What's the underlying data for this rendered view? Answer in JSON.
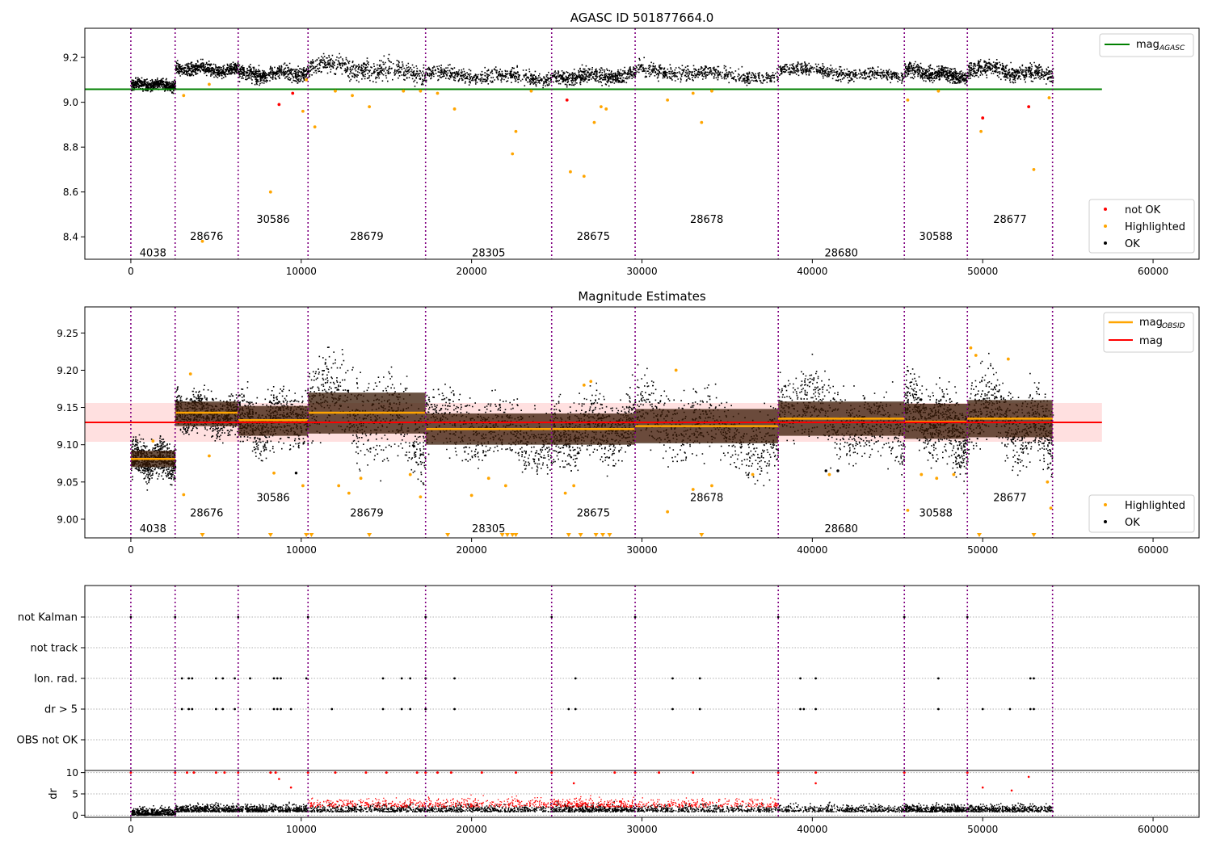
{
  "chart_data": [
    {
      "type": "scatter",
      "title": "AGASC ID 501877664.0",
      "xlim": [
        -2700,
        62700
      ],
      "ylim": [
        8.3,
        9.33
      ],
      "xticks": [
        0,
        10000,
        20000,
        30000,
        40000,
        50000,
        60000
      ],
      "yticks": [
        8.4,
        8.6,
        8.8,
        9.0,
        9.2
      ],
      "ytick_labels": [
        "8.4",
        "8.6",
        "8.8",
        "9.0",
        "9.2"
      ],
      "reference_line": {
        "label": "mag",
        "label_sub": "AGASC",
        "value": 9.058,
        "x_range": [
          -2700,
          57000
        ],
        "color": "#008000"
      },
      "legend_upper": [
        {
          "label": "mag",
          "label_sub": "AGASC",
          "color": "#008000",
          "kind": "line"
        }
      ],
      "legend_lower": [
        {
          "label": "not OK",
          "color": "#ff0000",
          "kind": "dot"
        },
        {
          "label": "Highlighted",
          "color": "#ffa500",
          "kind": "dot"
        },
        {
          "label": "OK",
          "color": "#000000",
          "kind": "dot"
        }
      ],
      "segments": [
        {
          "obsid": "4038",
          "start": 0,
          "end": 2600,
          "level": 9.08,
          "spread": 0.012
        },
        {
          "obsid": "28676",
          "start": 2600,
          "end": 6300,
          "level": 9.15,
          "spread": 0.014
        },
        {
          "obsid": "30586",
          "start": 6300,
          "end": 10400,
          "level": 9.13,
          "spread": 0.016
        },
        {
          "obsid": "28679",
          "start": 10400,
          "end": 17300,
          "level": 9.15,
          "spread": 0.022
        },
        {
          "obsid": "28305",
          "start": 17300,
          "end": 24700,
          "level": 9.12,
          "spread": 0.016
        },
        {
          "obsid": "28675",
          "start": 24700,
          "end": 29600,
          "level": 9.12,
          "spread": 0.016
        },
        {
          "obsid": "28678",
          "start": 29600,
          "end": 38000,
          "level": 9.13,
          "spread": 0.016
        },
        {
          "obsid": "28680",
          "start": 38000,
          "end": 45400,
          "level": 9.135,
          "spread": 0.014
        },
        {
          "obsid": "30588",
          "start": 45400,
          "end": 49100,
          "level": 9.13,
          "spread": 0.016
        },
        {
          "obsid": "28677",
          "start": 49100,
          "end": 54100,
          "level": 9.14,
          "spread": 0.018
        }
      ],
      "obsid_label_rows": [
        8.33,
        8.405,
        8.48,
        8.405,
        8.33,
        8.405,
        8.48,
        8.33,
        8.405,
        8.48,
        8.33
      ],
      "highlighted_points": [
        [
          3100,
          9.03
        ],
        [
          4200,
          8.38
        ],
        [
          4600,
          9.08
        ],
        [
          8200,
          8.6
        ],
        [
          10100,
          8.96
        ],
        [
          10300,
          9.1
        ],
        [
          10800,
          8.89
        ],
        [
          12000,
          9.05
        ],
        [
          13000,
          9.03
        ],
        [
          14000,
          8.98
        ],
        [
          16000,
          9.05
        ],
        [
          17000,
          9.05
        ],
        [
          18000,
          9.04
        ],
        [
          19000,
          8.97
        ],
        [
          22400,
          8.77
        ],
        [
          22600,
          8.87
        ],
        [
          23500,
          9.05
        ],
        [
          25800,
          8.69
        ],
        [
          26600,
          8.67
        ],
        [
          27200,
          8.91
        ],
        [
          27600,
          8.98
        ],
        [
          27900,
          8.97
        ],
        [
          31500,
          9.01
        ],
        [
          33000,
          9.04
        ],
        [
          33500,
          8.91
        ],
        [
          34100,
          9.05
        ],
        [
          45600,
          9.01
        ],
        [
          47400,
          9.05
        ],
        [
          49900,
          8.87
        ],
        [
          53000,
          8.7
        ],
        [
          53900,
          9.02
        ]
      ],
      "not_ok_points": [
        [
          8700,
          8.99
        ],
        [
          9500,
          9.04
        ],
        [
          25600,
          9.01
        ],
        [
          50000,
          8.93
        ],
        [
          52700,
          8.98
        ]
      ]
    },
    {
      "type": "scatter",
      "title": "Magnitude Estimates",
      "xlim": [
        -2700,
        62700
      ],
      "ylim": [
        8.975,
        9.285
      ],
      "xticks": [
        0,
        10000,
        20000,
        30000,
        40000,
        50000,
        60000
      ],
      "yticks": [
        9.0,
        9.05,
        9.1,
        9.15,
        9.2,
        9.25
      ],
      "ytick_labels": [
        "9.00",
        "9.05",
        "9.10",
        "9.15",
        "9.20",
        "9.25"
      ],
      "mag": {
        "label": "mag",
        "value": 9.13,
        "band": [
          9.104,
          9.156
        ],
        "x_range": [
          -2700,
          57000
        ],
        "color": "#ff0000"
      },
      "legend_upper": [
        {
          "label": "mag",
          "label_sub": "OBSID",
          "color": "#ffa500",
          "kind": "line"
        },
        {
          "label": "mag",
          "color": "#ff0000",
          "kind": "line"
        }
      ],
      "legend_lower": [
        {
          "label": "Highlighted",
          "color": "#ffa500",
          "kind": "dot"
        },
        {
          "label": "OK",
          "color": "#000000",
          "kind": "dot"
        }
      ],
      "segments": [
        {
          "obsid": "4038",
          "start": 0,
          "end": 2600,
          "level": 9.081,
          "spread": 0.012,
          "mag_obsid": 9.081,
          "band": [
            9.07,
            9.092
          ]
        },
        {
          "obsid": "28676",
          "start": 2600,
          "end": 6300,
          "level": 9.143,
          "spread": 0.014,
          "mag_obsid": 9.143,
          "band": [
            9.125,
            9.158
          ]
        },
        {
          "obsid": "30586",
          "start": 6300,
          "end": 10400,
          "level": 9.133,
          "spread": 0.018,
          "mag_obsid": 9.133,
          "band": [
            9.112,
            9.152
          ]
        },
        {
          "obsid": "28679",
          "start": 10400,
          "end": 17300,
          "level": 9.143,
          "spread": 0.028,
          "mag_obsid": 9.143,
          "band": [
            9.115,
            9.17
          ]
        },
        {
          "obsid": "28305",
          "start": 17300,
          "end": 24700,
          "level": 9.121,
          "spread": 0.02,
          "mag_obsid": 9.121,
          "band": [
            9.1,
            9.142
          ]
        },
        {
          "obsid": "28675",
          "start": 24700,
          "end": 29600,
          "level": 9.121,
          "spread": 0.02,
          "mag_obsid": 9.121,
          "band": [
            9.1,
            9.142
          ]
        },
        {
          "obsid": "28678",
          "start": 29600,
          "end": 38000,
          "level": 9.125,
          "spread": 0.022,
          "mag_obsid": 9.125,
          "band": [
            9.102,
            9.148
          ]
        },
        {
          "obsid": "28680",
          "start": 38000,
          "end": 45400,
          "level": 9.135,
          "spread": 0.022,
          "mag_obsid": 9.135,
          "band": [
            9.112,
            9.158
          ]
        },
        {
          "obsid": "30588",
          "start": 45400,
          "end": 49100,
          "level": 9.131,
          "spread": 0.022,
          "mag_obsid": 9.131,
          "band": [
            9.108,
            9.155
          ]
        },
        {
          "obsid": "28677",
          "start": 49100,
          "end": 54100,
          "level": 9.135,
          "spread": 0.024,
          "mag_obsid": 9.135,
          "band": [
            9.11,
            9.16
          ]
        }
      ],
      "obsid_label_rows": [
        8.988,
        9.009,
        9.03,
        9.009,
        8.988,
        9.009,
        9.03,
        8.988,
        9.009,
        9.03,
        8.988
      ],
      "highlighted_points": [
        [
          1300,
          9.105
        ],
        [
          3100,
          9.033
        ],
        [
          3500,
          9.195
        ],
        [
          4600,
          9.085
        ],
        [
          8400,
          9.062
        ],
        [
          10100,
          9.045
        ],
        [
          12200,
          9.045
        ],
        [
          12800,
          9.035
        ],
        [
          13500,
          9.055
        ],
        [
          16400,
          9.06
        ],
        [
          17000,
          9.03
        ],
        [
          20000,
          9.032
        ],
        [
          21000,
          9.055
        ],
        [
          22000,
          9.045
        ],
        [
          25500,
          9.035
        ],
        [
          26000,
          9.045
        ],
        [
          26600,
          9.18
        ],
        [
          27000,
          9.185
        ],
        [
          31500,
          9.01
        ],
        [
          32000,
          9.2
        ],
        [
          33000,
          9.04
        ],
        [
          34100,
          9.045
        ],
        [
          36500,
          9.06
        ],
        [
          41000,
          9.06
        ],
        [
          45600,
          9.012
        ],
        [
          46400,
          9.06
        ],
        [
          47300,
          9.055
        ],
        [
          48300,
          9.06
        ],
        [
          49300,
          9.23
        ],
        [
          49600,
          9.22
        ],
        [
          51500,
          9.215
        ],
        [
          53800,
          9.05
        ],
        [
          54000,
          9.015
        ]
      ],
      "triangle_points": [
        4200,
        8200,
        10300,
        10600,
        14000,
        18600,
        21800,
        22100,
        22400,
        22600,
        25700,
        26400,
        27300,
        27700,
        28100,
        33500,
        49800,
        53000
      ],
      "ok_isolated_points": [
        [
          9700,
          9.062
        ],
        [
          40800,
          9.065
        ],
        [
          41500,
          9.065
        ]
      ]
    },
    {
      "type": "scatter",
      "xlim": [
        -2700,
        62700
      ],
      "xticks": [
        0,
        10000,
        20000,
        30000,
        40000,
        50000,
        60000
      ],
      "flag_rows": [
        "not Kalman",
        "not track",
        "Ion. rad.",
        "dr > 5",
        "OBS not OK"
      ],
      "flags": {
        "not Kalman": [
          0,
          2600,
          6300,
          10400,
          17300,
          24700,
          29600,
          38000,
          45400,
          49100
        ],
        "not track": [],
        "Ion. rad.": [
          3000,
          3400,
          3600,
          5000,
          5400,
          6100,
          7000,
          8400,
          8600,
          8800,
          10300,
          14800,
          15900,
          16400,
          17300,
          19000,
          26100,
          31800,
          33400,
          39300,
          40200,
          47400,
          52800,
          53000
        ],
        "dr > 5": [
          3000,
          3400,
          3600,
          5000,
          5400,
          6100,
          7000,
          8400,
          8600,
          8800,
          9400,
          11800,
          14800,
          15900,
          16400,
          17300,
          19000,
          25700,
          26100,
          31800,
          33400,
          39300,
          39500,
          40200,
          47400,
          50000,
          51600,
          52800,
          53000
        ]
      },
      "dr": {
        "ylabel": "dr",
        "ylim": [
          -0.5,
          10.5
        ],
        "yticks": [
          0,
          5,
          10
        ],
        "ytick_labels": [
          "0",
          "5",
          "10"
        ],
        "saturated_points": [
          0,
          2600,
          3300,
          3700,
          5000,
          5500,
          6300,
          8200,
          8500,
          10400,
          12000,
          13800,
          15000,
          16800,
          17300,
          18000,
          18800,
          20600,
          22600,
          24700,
          28400,
          29600,
          31000,
          33000,
          38000,
          40200,
          45400,
          49100
        ],
        "mid_points": [
          [
            8700,
            8.5
          ],
          [
            9400,
            6.5
          ],
          [
            26000,
            7.5
          ],
          [
            40200,
            7.5
          ],
          [
            50000,
            6.5
          ],
          [
            51700,
            5.8
          ],
          [
            52700,
            9.0
          ]
        ]
      }
    }
  ]
}
